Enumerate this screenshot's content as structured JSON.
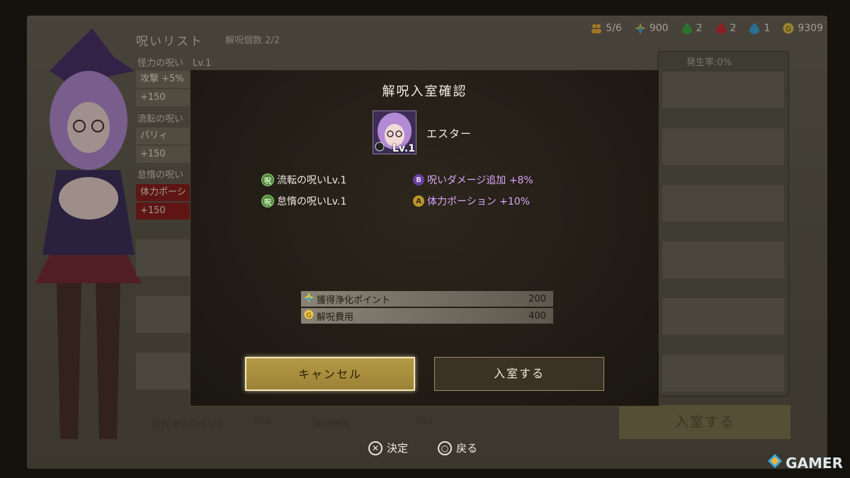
{
  "currency": [
    {
      "icon": "party-icon",
      "value": "5/6",
      "color": "#f2b33a"
    },
    {
      "icon": "purify-point-icon",
      "value": "900",
      "color": "#d8c84a"
    },
    {
      "icon": "green-gem-icon",
      "value": "2",
      "color": "#3fae44"
    },
    {
      "icon": "red-gem-icon",
      "value": "2",
      "color": "#d52c32"
    },
    {
      "icon": "blue-gem-icon",
      "value": "1",
      "color": "#3aa8e0"
    },
    {
      "icon": "gold-coin-icon",
      "value": "9309",
      "color": "#e8c44a"
    }
  ],
  "background": {
    "list_title": "呪いリスト",
    "list_count": "解呪個数 2/2",
    "curse1_name": "怪力の呪い　Lv.1",
    "curse1_effect": "攻撃 +5%",
    "curse1_points": "+150",
    "curse2_name": "流転の呪い",
    "curse2_effect": "パリィ",
    "curse2_points": "+150",
    "curse3_name": "怠惰の呪い",
    "curse3_effect": "体力ポーシ",
    "curse3_points": "+150",
    "occurrence_rate": "発生率:0%",
    "bottom_points_label": "獲得浄化ポイント",
    "bottom_points_value": "200",
    "bottom_cost_label": "解呪費用",
    "bottom_cost_value": "400",
    "enter_label": "入室する"
  },
  "controls": {
    "confirm": "決定",
    "back": "戻る"
  },
  "watermark": "GAMER",
  "modal": {
    "title": "解呪入室確認",
    "character_name": "エスター",
    "character_level": "Lv.1",
    "curses": [
      {
        "name": "流転の呪いLv.1"
      },
      {
        "name": "怠惰の呪いLv.1"
      }
    ],
    "effects": [
      {
        "badge": "B",
        "text": "呪いダメージ追加 +8%"
      },
      {
        "badge": "A",
        "text": "体力ポーション +10%"
      }
    ],
    "points_label": "獲得浄化ポイント",
    "points_value": "200",
    "cost_label": "解呪費用",
    "cost_value": "400",
    "cancel_label": "キャンセル",
    "enter_label": "入室する"
  }
}
